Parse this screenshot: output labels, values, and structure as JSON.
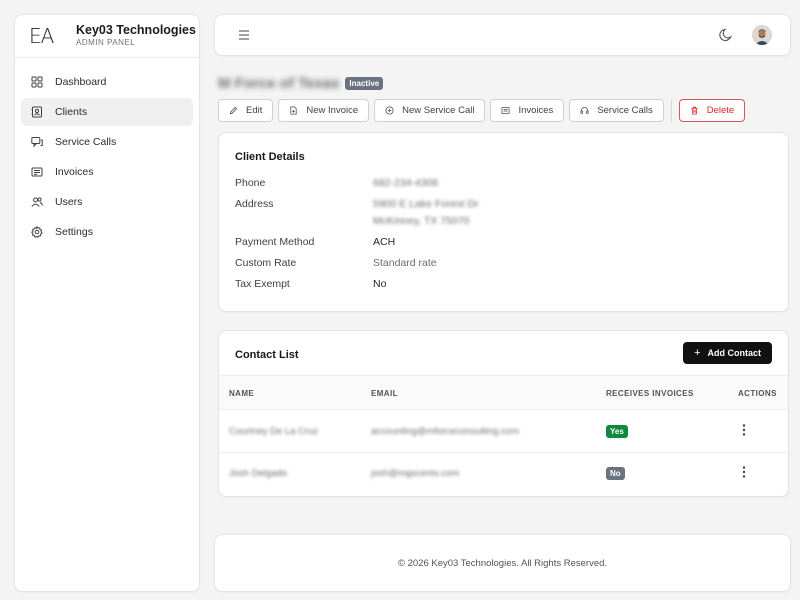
{
  "brand": {
    "logo": "EA",
    "name": "Key03 Technologies",
    "subtitle": "ADMIN PANEL"
  },
  "sidebar": {
    "items": [
      {
        "label": "Dashboard",
        "icon": "grid-icon"
      },
      {
        "label": "Clients",
        "icon": "contact-card-icon",
        "active": true
      },
      {
        "label": "Service Calls",
        "icon": "chat-icon"
      },
      {
        "label": "Invoices",
        "icon": "invoice-icon"
      },
      {
        "label": "Users",
        "icon": "users-icon"
      },
      {
        "label": "Settings",
        "icon": "gear-icon"
      }
    ]
  },
  "topbar": {
    "menu_icon": "hamburger-icon",
    "theme_icon": "moon-icon",
    "avatar_icon": "user-avatar"
  },
  "client": {
    "name": "M Force of Texas",
    "status": "Inactive"
  },
  "actions": {
    "edit": "Edit",
    "new_invoice": "New Invoice",
    "new_service_call": "New Service Call",
    "invoices": "Invoices",
    "service_calls": "Service Calls",
    "delete": "Delete"
  },
  "details": {
    "title": "Client Details",
    "phone_label": "Phone",
    "phone": "682-234-4306",
    "address_label": "Address",
    "address_line1": "5900 E Lake Forest Dr",
    "address_line2": "McKinney, TX 75070",
    "payment_label": "Payment Method",
    "payment": "ACH",
    "rate_label": "Custom Rate",
    "rate": "Standard rate",
    "tax_label": "Tax Exempt",
    "tax": "No"
  },
  "contacts": {
    "title": "Contact List",
    "add_label": "Add Contact",
    "columns": {
      "name": "NAME",
      "email": "EMAIL",
      "receives": "RECEIVES INVOICES",
      "actions": "ACTIONS"
    },
    "rows": [
      {
        "name": "Courtney De La Cruz",
        "email": "accounting@mforceconsulting.com",
        "receives": "Yes"
      },
      {
        "name": "Josh Delgado",
        "email": "josh@mgscents.com",
        "receives": "No"
      }
    ]
  },
  "footer": {
    "text": "© 2026 Key03 Technologies. All Rights Reserved."
  },
  "colors": {
    "accent": "#111113",
    "danger": "#dc2626",
    "success": "#0f8a3c",
    "muted_badge": "#6b7280"
  }
}
